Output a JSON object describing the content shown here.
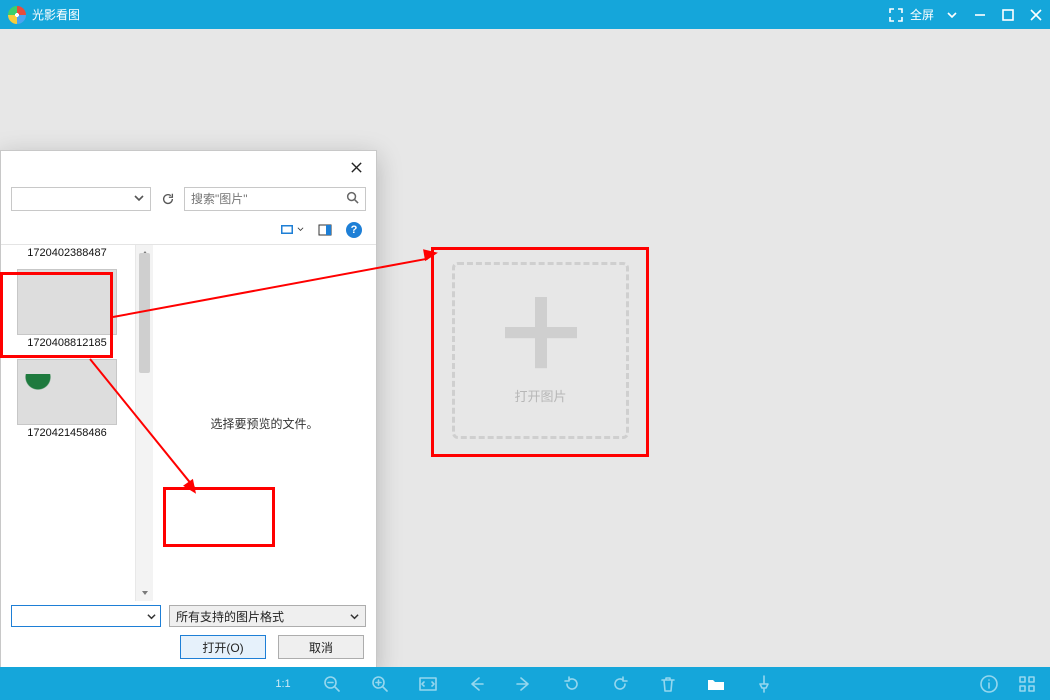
{
  "titlebar": {
    "app_title": "光影看图",
    "fullscreen_label": "全屏"
  },
  "drop": {
    "label": "打开图片"
  },
  "dialog": {
    "search_placeholder": "搜索\"图片\"",
    "preview_empty_text": "选择要预览的文件。",
    "help_char": "?",
    "thumbs": [
      {
        "name": "1720402388487",
        "variant": "blank"
      },
      {
        "name": "1720408812185",
        "variant": "food"
      },
      {
        "name": "1720421458486",
        "variant": "beach"
      }
    ],
    "filter_label": "所有支持的图片格式",
    "open_btn": "打开(O)",
    "cancel_btn": "取消"
  },
  "bottombar": {
    "ratio": "1:1"
  }
}
